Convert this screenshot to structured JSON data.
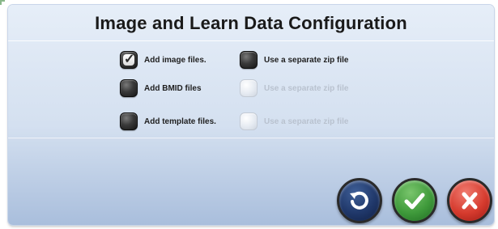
{
  "dialog": {
    "title": "Image and Learn Data Configuration"
  },
  "options": [
    {
      "label": "Add image files.",
      "checked": true,
      "enabled": true
    },
    {
      "label": "Use a separate zip file",
      "checked": false,
      "enabled": true
    },
    {
      "label": "Add BMID files",
      "checked": false,
      "enabled": true
    },
    {
      "label": "Use a separate zip file",
      "checked": false,
      "enabled": false
    },
    {
      "label": "Add template files.",
      "checked": false,
      "enabled": true
    },
    {
      "label": "Use a separate zip file",
      "checked": false,
      "enabled": false
    }
  ],
  "buttons": {
    "undo": {
      "icon": "undo-icon",
      "color": "#20386a"
    },
    "ok": {
      "icon": "check-icon",
      "color": "#3f9a3b"
    },
    "cancel": {
      "icon": "close-icon",
      "color": "#d63b2e"
    }
  },
  "colors": {
    "dialog_top": "#e6eef8",
    "dialog_bottom": "#a9bedc",
    "disabled_text": "#b9c2cf"
  }
}
